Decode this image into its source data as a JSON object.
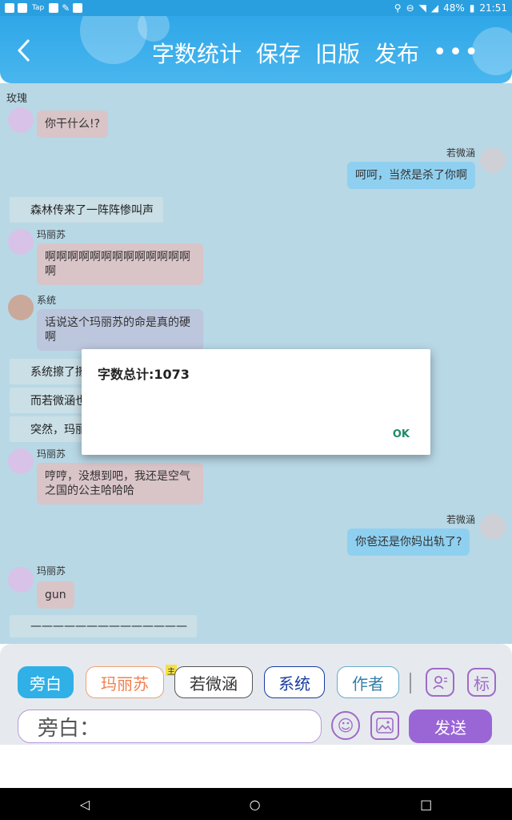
{
  "status_bar": {
    "left_icons": [
      "app-icon-1",
      "app-icon-2",
      "tap-icon",
      "app-icon-3",
      "settings-icon",
      "image-icon"
    ],
    "tap_text": "Tap",
    "battery": "48%",
    "time": "21:51"
  },
  "header": {
    "back_icon": "chevron-left-icon",
    "actions": [
      "字数统计",
      "保存",
      "旧版",
      "发布"
    ],
    "more_icon": "more-dots-icon"
  },
  "chat": {
    "top_label": "玫瑰",
    "messages": [
      {
        "type": "left",
        "text": "你干什么!?"
      },
      {
        "type": "right",
        "name": "若微涵",
        "text": "呵呵，当然是杀了你啊"
      },
      {
        "type": "narration",
        "text": "森林传来了一阵阵惨叫声"
      },
      {
        "type": "left",
        "name": "玛丽苏",
        "text": "啊啊啊啊啊啊啊啊啊啊啊啊啊啊"
      },
      {
        "type": "left",
        "name": "系统",
        "text": "话说这个玛丽苏的命是真的硬啊"
      },
      {
        "type": "narration",
        "text": "系统擦了擦"
      },
      {
        "type": "narration",
        "text": "而若微涵也"
      },
      {
        "type": "narration",
        "text": "突然，玛丽苏"
      },
      {
        "type": "left",
        "name": "玛丽苏",
        "text": "哼哼，没想到吧，我还是空气之国的公主哈哈哈"
      },
      {
        "type": "right",
        "name": "若微涵",
        "text": "你爸还是你妈出轨了?"
      },
      {
        "type": "left",
        "name": "玛丽苏",
        "text": "gun"
      },
      {
        "type": "narration",
        "text": "——————————————"
      }
    ]
  },
  "dialog": {
    "title": "字数总计:1073",
    "ok_label": "OK"
  },
  "bottom": {
    "roles": [
      "旁白",
      "玛丽苏",
      "若微涵",
      "系统",
      "作者"
    ],
    "main_badge": "主",
    "role_icon": "person-card-icon",
    "tag_label": "标",
    "input_text": "旁白：",
    "emoji_icon": "smile-icon",
    "image_icon": "image-icon",
    "send_label": "发送"
  },
  "navbar": {
    "back": "◁",
    "home": "○",
    "recent": "□"
  }
}
